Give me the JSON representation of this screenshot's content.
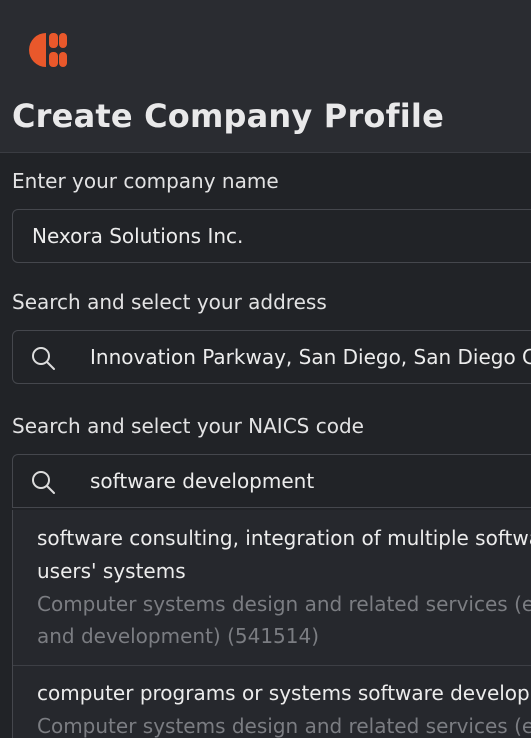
{
  "header": {
    "title": "Create Company Profile",
    "logo_icon": "brand-logo-icon",
    "accent_color": "#e9582b"
  },
  "company": {
    "label": "Enter your company name",
    "value": "Nexora Solutions Inc."
  },
  "address": {
    "label": "Search and select your address",
    "value": "Innovation Parkway, San Diego, San Diego County",
    "icon": "search-icon"
  },
  "naics": {
    "label": "Search and select your NAICS code",
    "value": "software development",
    "icon": "search-icon",
    "options": [
      {
        "title_line1": "software consulting, integration of multiple software",
        "title_line2": "users' systems",
        "desc_line1": "Computer systems design and related services (except",
        "desc_line2": "and development) (541514)"
      },
      {
        "title_line1": "computer programs or systems software development",
        "desc_line1": "Computer systems design and related services (except"
      }
    ]
  }
}
